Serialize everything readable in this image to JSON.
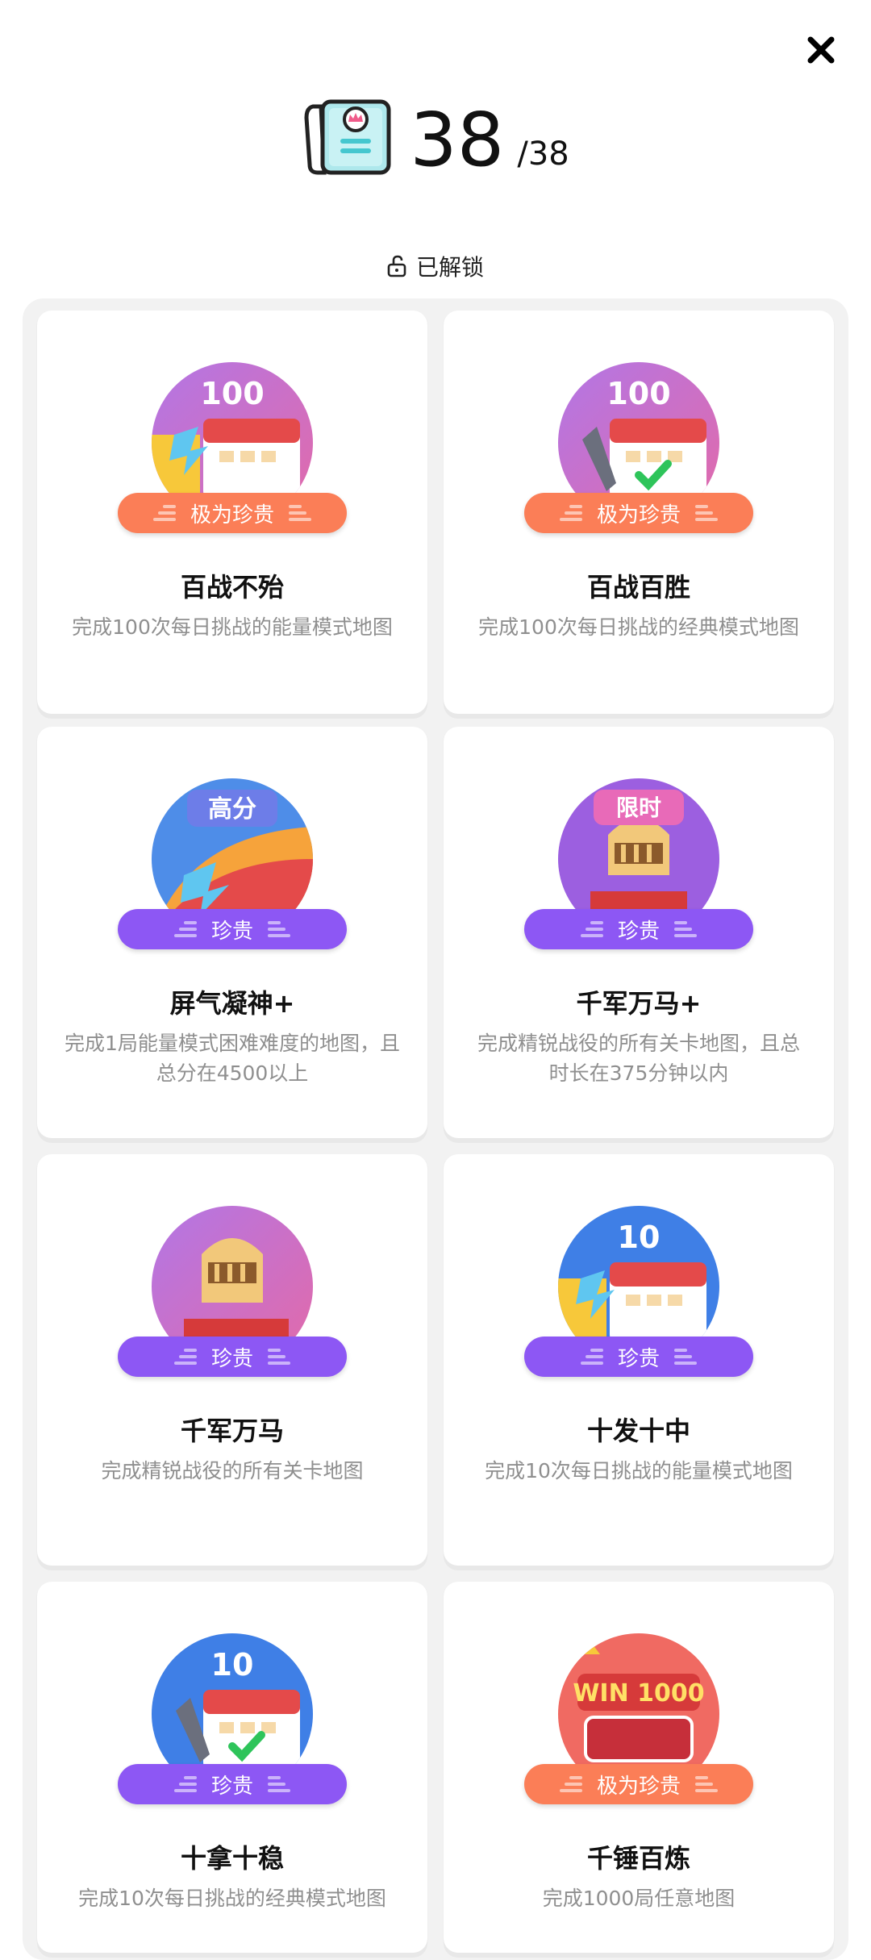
{
  "header": {
    "count": "38",
    "total": "/38",
    "unlocked_label": "已解锁"
  },
  "colors": {
    "rare_pill": "#fb7e57",
    "common_pill": "#8d57f4"
  },
  "achievements": [
    {
      "title": "百战不殆",
      "desc": "完成100次每日挑战的能量模式地图",
      "rarity": "极为珍贵",
      "rarity_type": "rare",
      "medal_text": "100",
      "icon": "calendar-energy-medal-icon"
    },
    {
      "title": "百战百胜",
      "desc": "完成100次每日挑战的经典模式地图",
      "rarity": "极为珍贵",
      "rarity_type": "rare",
      "medal_text": "100",
      "icon": "calendar-shovel-medal-icon"
    },
    {
      "title": "屏气凝神+",
      "desc": "完成1局能量模式困难难度的地图，且总分在4500以上",
      "rarity": "珍贵",
      "rarity_type": "common",
      "medal_text": "高分",
      "icon": "high-score-medal-icon"
    },
    {
      "title": "千军万马+",
      "desc": "完成精锐战役的所有关卡地图，且总时长在375分钟以内",
      "rarity": "珍贵",
      "rarity_type": "common",
      "medal_text": "限时",
      "icon": "knight-timed-medal-icon"
    },
    {
      "title": "千军万马",
      "desc": "完成精锐战役的所有关卡地图",
      "rarity": "珍贵",
      "rarity_type": "common",
      "medal_text": "",
      "icon": "knight-medal-icon"
    },
    {
      "title": "十发十中",
      "desc": "完成10次每日挑战的能量模式地图",
      "rarity": "珍贵",
      "rarity_type": "common",
      "medal_text": "10",
      "icon": "calendar-energy-10-medal-icon"
    },
    {
      "title": "十拿十稳",
      "desc": "完成10次每日挑战的经典模式地图",
      "rarity": "珍贵",
      "rarity_type": "common",
      "medal_text": "10",
      "icon": "calendar-shovel-10-medal-icon"
    },
    {
      "title": "千锤百炼",
      "desc": "完成1000局任意地图",
      "rarity": "极为珍贵",
      "rarity_type": "rare",
      "medal_text": "WIN 1000",
      "icon": "win-1000-medal-icon"
    }
  ]
}
